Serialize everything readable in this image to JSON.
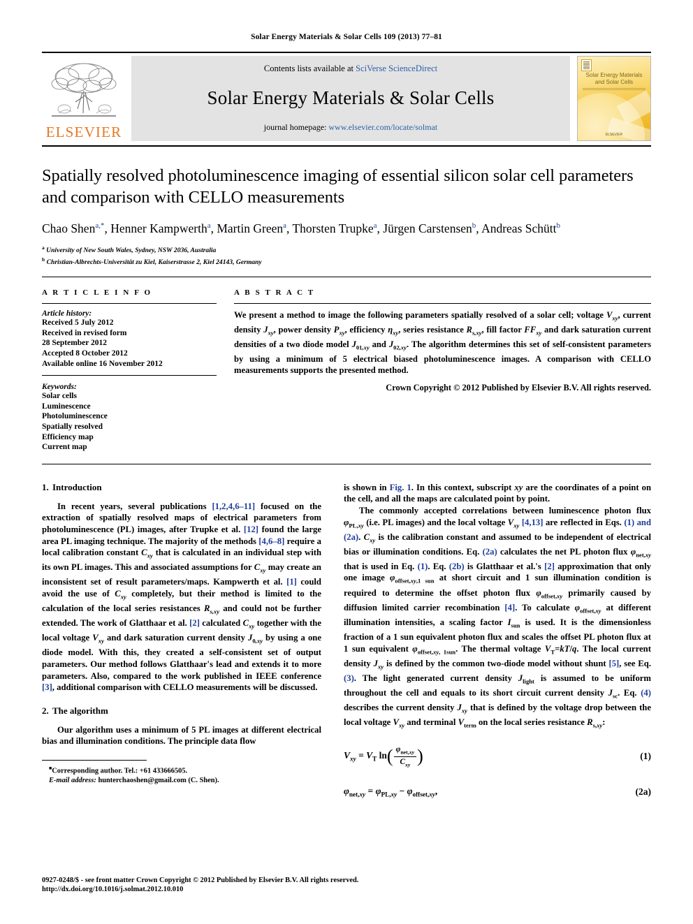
{
  "running_head": "Solar Energy Materials & Solar Cells 109 (2013) 77–81",
  "masthead": {
    "publisher_name": "ELSEVIER",
    "contents_prefix": "Contents lists available at ",
    "contents_link": "SciVerse ScienceDirect",
    "journal_title": "Solar Energy Materials & Solar Cells",
    "homepage_prefix": "journal homepage: ",
    "homepage_link": "www.elsevier.com/locate/solmat",
    "cover_title_line1": "Solar Energy Materials",
    "cover_title_line2": "and Solar Cells",
    "cover_footer": "ELSEVIER",
    "link_color": "#2b5fa8",
    "banner_bg": "#e3e3e3",
    "elsevier_orange": "#E87722"
  },
  "article": {
    "title": "Spatially resolved photoluminescence imaging of essential silicon solar cell parameters and comparison with CELLO measurements",
    "authors": [
      {
        "name": "Chao Shen",
        "marks": "a,*"
      },
      {
        "name": "Henner Kampwerth",
        "marks": "a"
      },
      {
        "name": "Martin Green",
        "marks": "a"
      },
      {
        "name": "Thorsten Trupke",
        "marks": "a"
      },
      {
        "name": "Jürgen Carstensen",
        "marks": "b"
      },
      {
        "name": "Andreas Schütt",
        "marks": "b"
      }
    ],
    "affiliations": [
      {
        "mark": "a",
        "text": "University of New South Wales, Sydney, NSW 2036, Australia"
      },
      {
        "mark": "b",
        "text": "Christian-Albrechts-Universität zu Kiel, Kaiserstrasse 2, Kiel 24143, Germany"
      }
    ]
  },
  "article_info": {
    "heading": "A R T I C L E   I N F O",
    "history_label": "Article history:",
    "history": [
      "Received 5 July 2012",
      "Received in revised form",
      "28 September 2012",
      "Accepted 8 October 2012",
      "Available online 16 November 2012"
    ],
    "keywords_label": "Keywords:",
    "keywords": [
      "Solar cells",
      "Luminescence",
      "Photoluminescence",
      "Spatially resolved",
      "Efficiency map",
      "Current map"
    ]
  },
  "abstract": {
    "heading": "A B S T R A C T",
    "copyright": "Crown Copyright © 2012 Published by Elsevier B.V. All rights reserved."
  },
  "sections": {
    "intro_num": "1.",
    "intro_title": "Introduction",
    "algo_num": "2.",
    "algo_title": "The algorithm"
  },
  "footnote": {
    "corresponding": "Corresponding author. Tel.: +61 433666505.",
    "email_label": "E-mail address:",
    "email": "hunterchaoshen@gmail.com (C. Shen)."
  },
  "footer": {
    "issn_line": "0927-0248/$ - see front matter Crown Copyright © 2012 Published by Elsevier B.V. All rights reserved.",
    "doi_line": "http://dx.doi.org/10.1016/j.solmat.2012.10.010"
  },
  "equations": [
    {
      "number": "(1)"
    },
    {
      "number": "(2a)"
    }
  ]
}
